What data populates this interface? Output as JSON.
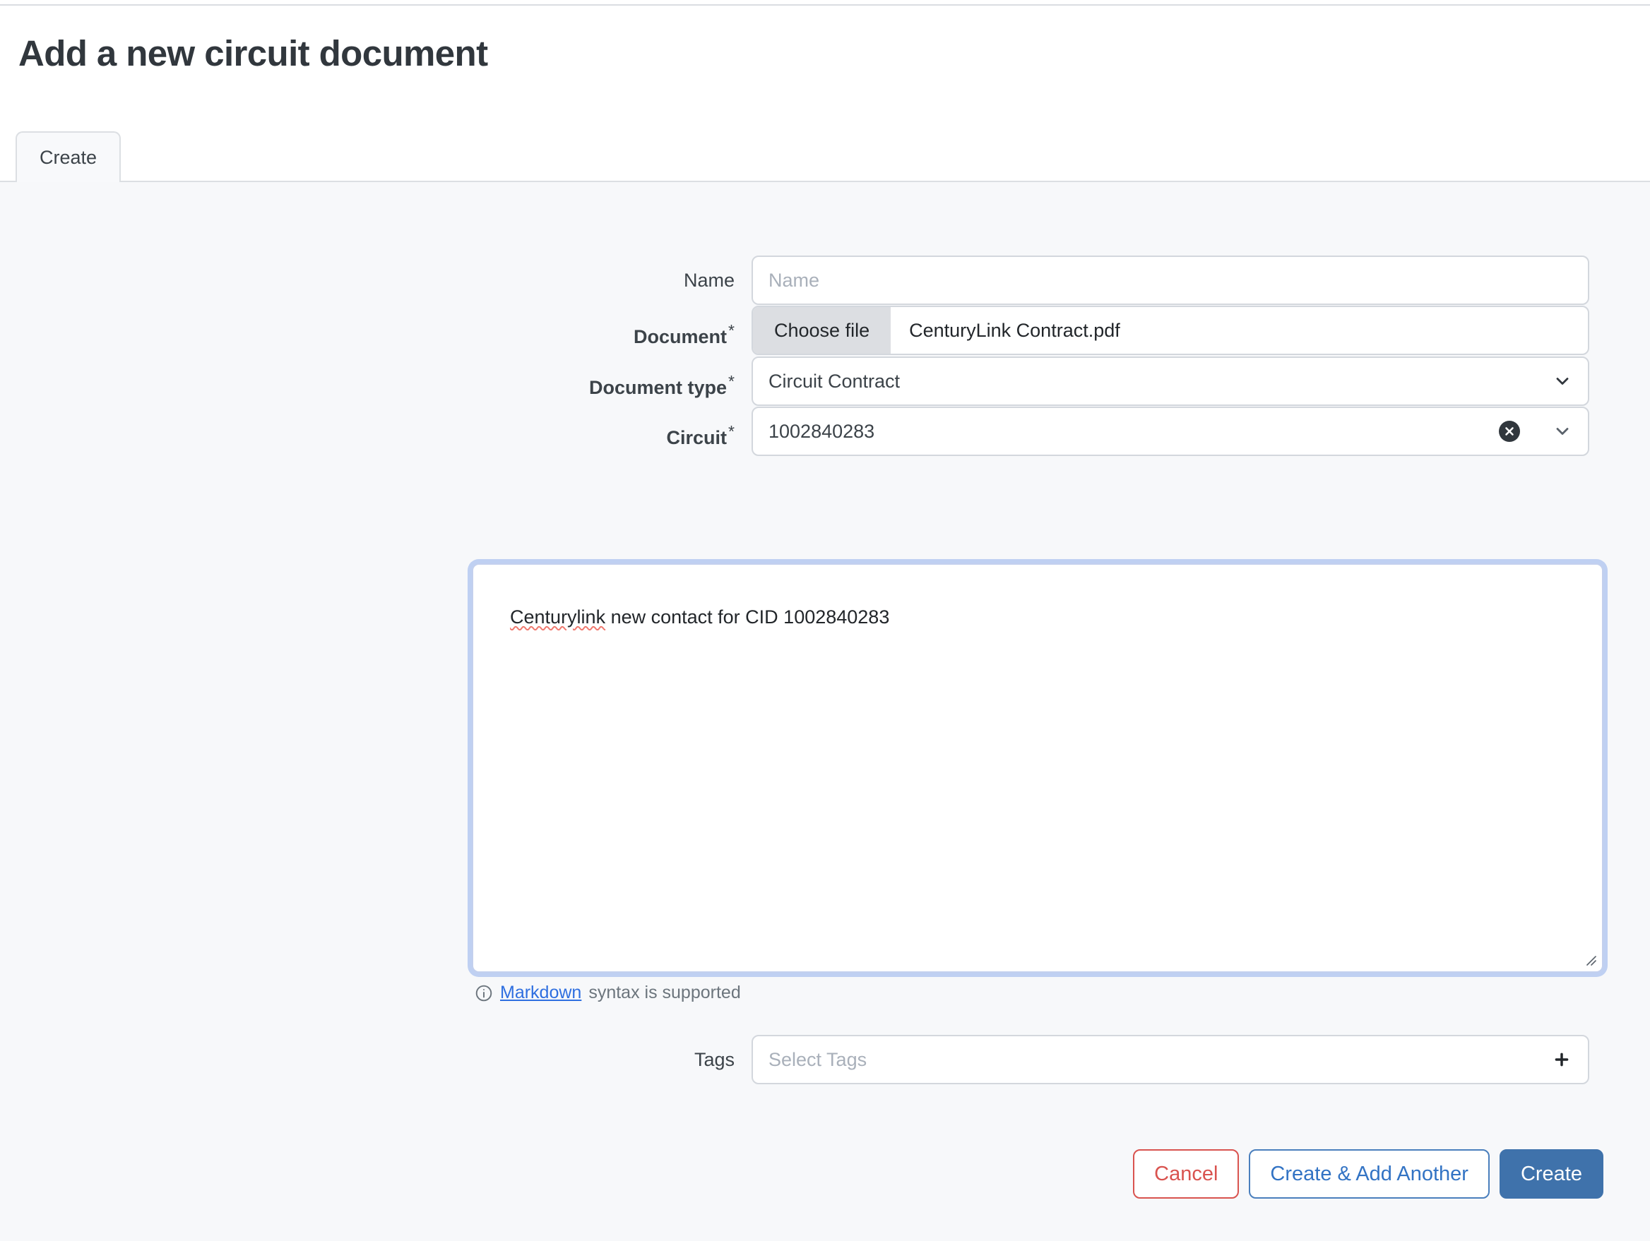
{
  "header": {
    "title": "Add a new circuit document"
  },
  "tabs": [
    {
      "label": "Create",
      "active": true
    }
  ],
  "form": {
    "name": {
      "label": "Name",
      "placeholder": "Name",
      "value": ""
    },
    "document": {
      "label": "Document",
      "required_mark": "*",
      "button_label": "Choose file",
      "file_name": "CenturyLink Contract.pdf"
    },
    "document_type": {
      "label": "Document type",
      "required_mark": "*",
      "value": "Circuit Contract"
    },
    "circuit": {
      "label": "Circuit",
      "required_mark": "*",
      "value": "1002840283"
    },
    "comments": {
      "value_misspelled": "Centurylink",
      "value_rest": " new contact for CID 1002840283",
      "full_value": "Centurylink new contact for CID 1002840283"
    },
    "markdown_hint": {
      "link_text": "Markdown",
      "rest_text": " syntax is supported"
    },
    "tags": {
      "label": "Tags",
      "placeholder": "Select Tags",
      "value": ""
    }
  },
  "footer": {
    "cancel_label": "Cancel",
    "create_add_another_label": "Create & Add Another",
    "create_label": "Create"
  },
  "colors": {
    "primary": "#3f72ab",
    "danger": "#d9534f",
    "link": "#2f6fe0",
    "focus_ring": "#bfd0f2",
    "page_bg": "#f7f8fa"
  }
}
